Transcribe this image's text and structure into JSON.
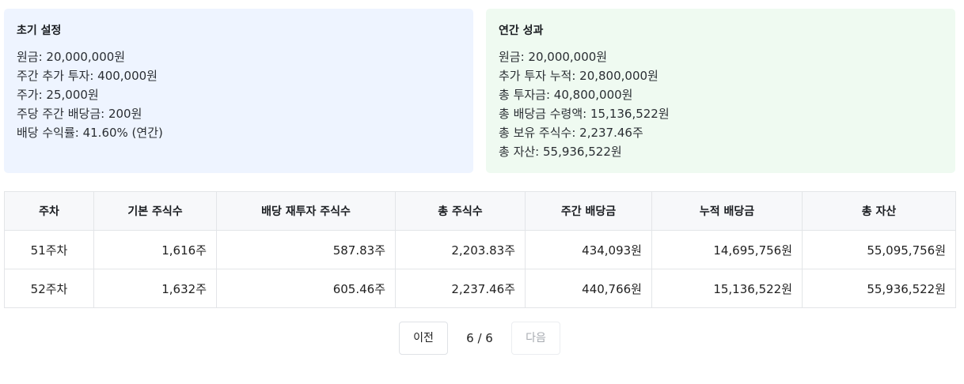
{
  "settings": {
    "title": "초기 설정",
    "lines": [
      "원금: 20,000,000원",
      "주간 추가 투자: 400,000원",
      "주가: 25,000원",
      "주당 주간 배당금: 200원",
      "배당 수익률: 41.60% (연간)"
    ]
  },
  "performance": {
    "title": "연간 성과",
    "lines": [
      "원금: 20,000,000원",
      "추가 투자 누적: 20,800,000원",
      "총 투자금: 40,800,000원",
      "총 배당금 수령액: 15,136,522원",
      "총 보유 주식수: 2,237.46주",
      "총 자산: 55,936,522원"
    ]
  },
  "table": {
    "headers": [
      "주차",
      "기본 주식수",
      "배당 재투자 주식수",
      "총 주식수",
      "주간 배당금",
      "누적 배당금",
      "총 자산"
    ],
    "rows": [
      [
        "51주차",
        "1,616주",
        "587.83주",
        "2,203.83주",
        "434,093원",
        "14,695,756원",
        "55,095,756원"
      ],
      [
        "52주차",
        "1,632주",
        "605.46주",
        "2,237.46주",
        "440,766원",
        "15,136,522원",
        "55,936,522원"
      ]
    ]
  },
  "pagination": {
    "prev_label": "이전",
    "page_info": "6 / 6",
    "next_label": "다음"
  },
  "colors": {
    "settings_bg": "#eef4ff",
    "performance_bg": "#effaf1",
    "disabled_text": "#a7abb1"
  }
}
